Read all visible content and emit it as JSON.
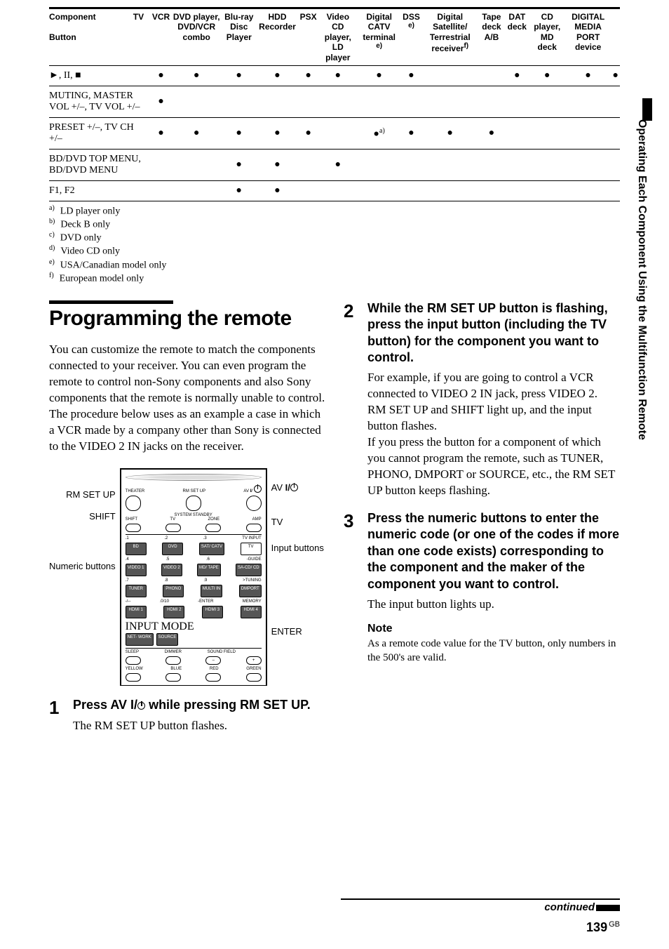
{
  "chart_data": {
    "type": "table",
    "title": "Remote button compatibility by component",
    "columns": [
      "Button",
      "TV",
      "VCR",
      "DVD player, DVD/VCR combo",
      "Blu-ray Disc Player",
      "HDD Recorder",
      "PSX",
      "Video CD player, LD player",
      "Digital CATV terminal e)",
      "DSS e)",
      "Digital Satellite/Terrestrial receiver f)",
      "Tape deck A/B",
      "DAT deck",
      "CD player, MD deck",
      "DIGITAL MEDIA PORT device"
    ],
    "rows": [
      {
        "button": "►, II, ■",
        "cells": [
          true,
          true,
          true,
          true,
          true,
          true,
          true,
          true,
          false,
          false,
          true,
          true,
          true,
          true
        ]
      },
      {
        "button": "MUTING, MASTER VOL +/–, TV VOL +/–",
        "cells": [
          true,
          false,
          false,
          false,
          false,
          false,
          false,
          false,
          false,
          false,
          false,
          false,
          false,
          false
        ]
      },
      {
        "button": "PRESET +/–, TV CH +/–",
        "cells": [
          true,
          true,
          true,
          true,
          true,
          false,
          "a)",
          true,
          true,
          true,
          false,
          false,
          false,
          false
        ]
      },
      {
        "button": "BD/DVD TOP MENU, BD/DVD MENU",
        "cells": [
          false,
          false,
          true,
          true,
          false,
          true,
          false,
          false,
          false,
          false,
          false,
          false,
          false,
          false
        ]
      },
      {
        "button": "F1, F2",
        "cells": [
          false,
          false,
          true,
          true,
          false,
          false,
          false,
          false,
          false,
          false,
          false,
          false,
          false,
          false
        ]
      }
    ]
  },
  "table": {
    "headers": [
      "Button",
      "TV",
      "VCR",
      "DVD player, DVD/VCR combo",
      "Blu-ray Disc Player",
      "HDD Recorder",
      "PSX",
      "Video CD player, LD player",
      "Digital CATV terminal",
      "DSS",
      "Digital Satellite/ Terrestrial receiver",
      "Tape deck A/B",
      "DAT deck",
      "CD player, MD deck",
      "DIGITAL MEDIA PORT device"
    ],
    "rows": [
      {
        "label": "►, II, ■"
      },
      {
        "label": "MUTING, MASTER VOL +/–, TV VOL +/–"
      },
      {
        "label": "PRESET +/–, TV CH +/–"
      },
      {
        "label": "BD/DVD TOP MENU, BD/DVD MENU"
      },
      {
        "label": "F1, F2"
      }
    ]
  },
  "footnotes": {
    "a": "LD player only",
    "b": "Deck B only",
    "c": "DVD only",
    "d": "Video CD only",
    "e": "USA/Canadian model only",
    "f": "European model only"
  },
  "heading": "Programming the remote",
  "intro": "You can customize the remote to match the components connected to your receiver. You can even program the remote to control non-Sony components and also Sony components that the remote is normally unable to control. The procedure below uses as an example a case in which a VCR made by a company other than Sony is connected to the VIDEO 2 IN jacks on the receiver.",
  "remote_labels": {
    "rm_set_up": "RM SET UP",
    "shift": "SHIFT",
    "numeric": "Numeric buttons",
    "av_io": "AV ",
    "tv": "TV",
    "input": "Input buttons",
    "enter": "ENTER"
  },
  "remote_buttons": {
    "theater": "THEATER",
    "rmsetup": "RM SET UP",
    "av": "AV",
    "shift": "SHIFT",
    "tv": "TV",
    "zone": "ZONE",
    "amp": "AMP",
    "sys": "SYSTEM STANDBY",
    "n1": ".1",
    "n2": ".2",
    "n3": ".3",
    "tvinput": "TV INPUT",
    "bd": "BD",
    "dvd": "DVD",
    "sat": "SAT/\nCATV",
    "tv2": "TV",
    "n4": ".4",
    "n5": ".5",
    "n6": ".6",
    "guide": "-GUIDE",
    "video1": "VIDEO\n1",
    "video2": "VIDEO\n2",
    "mdtape": "MD/\nTAPE",
    "sacd": "SA-CD/\nCD",
    "n7": ".7",
    "n8": ".8",
    "n9": ".9",
    "tuning": ">TUNING",
    "tuner": "TUNER",
    "phono": "PHONO",
    "multi": "MULTI\nIN",
    "dmport": "DMPORT",
    "slash": "-/--",
    "n0": ".0/10",
    "center": "-ENTER",
    "mem": "MEMORY",
    "hdmi1": "HDMI\n1",
    "hdmi2": "HDMI\n2",
    "hdmi3": "HDMI\n3",
    "hdmi4": "HDMI\n4",
    "inputmode": "INPUT MODE",
    "net": "NET-\nWORK",
    "source": "SOURCE",
    "sleep": "SLEEP",
    "dimmer": "DIMMER",
    "sf": "SOUND FIELD",
    "minus": "–",
    "plus": "+",
    "yellow": "YELLOW",
    "blue": "BLUE",
    "red": "RED",
    "green": "GREEN"
  },
  "steps": {
    "s1": {
      "head1": "Press AV ",
      "head2": " while pressing RM SET UP.",
      "body": "The RM SET UP button flashes."
    },
    "s2": {
      "head": "While the RM SET UP button is flashing, press the input button (including the TV button) for the component you want to control.",
      "body": "For example, if you are going to control a VCR connected to VIDEO 2 IN jack, press VIDEO 2.\nRM SET UP and SHIFT light up,  and the input button flashes.\nIf you press the button for a component of which you cannot program the remote, such as TUNER, PHONO, DMPORT or SOURCE, etc., the RM SET UP button keeps flashing."
    },
    "s3": {
      "head": "Press the numeric buttons to enter the numeric code (or one of the codes if more than one code exists) corresponding to the component and the maker of the component you want to control.",
      "body": "The input button lights up."
    }
  },
  "note": {
    "head": "Note",
    "body": "As a remote code value for the TV button, only numbers in the 500's are valid."
  },
  "side_label": "Operating Each Component Using the Multifunction Remote",
  "continued": "continued",
  "pagenum": "139",
  "pagenum_suffix": "GB",
  "io_label": "I/"
}
